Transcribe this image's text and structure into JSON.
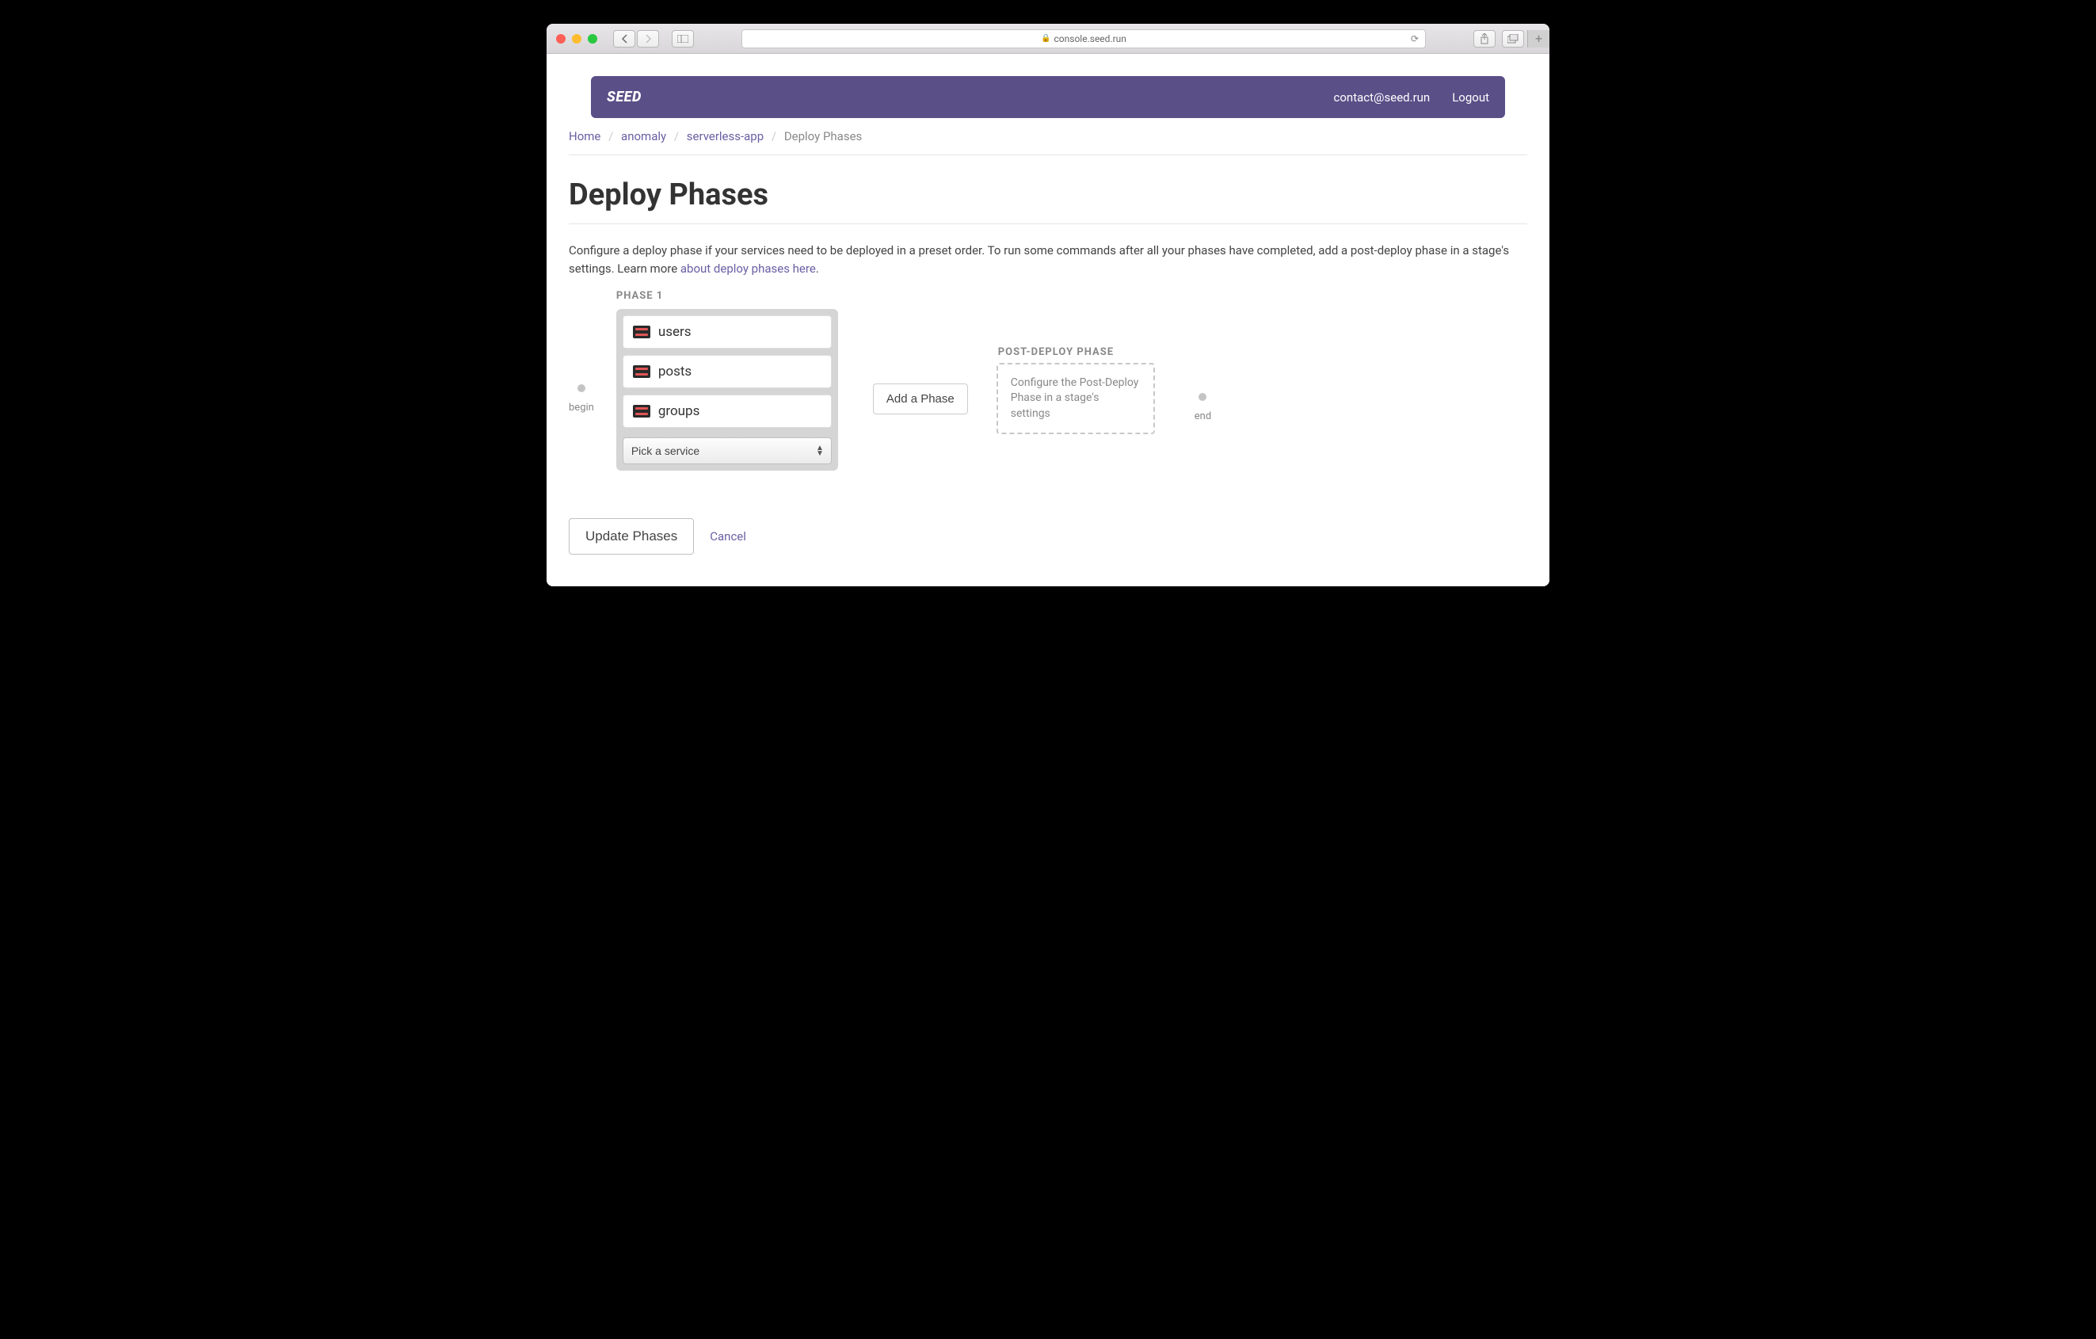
{
  "browser": {
    "url": "console.seed.run"
  },
  "nav": {
    "logo": "SEED",
    "email": "contact@seed.run",
    "logout": "Logout"
  },
  "breadcrumb": {
    "items": [
      {
        "label": "Home"
      },
      {
        "label": "anomaly"
      },
      {
        "label": "serverless-app"
      }
    ],
    "current": "Deploy Phases"
  },
  "page": {
    "title": "Deploy Phases",
    "description_pre": "Configure a deploy phase if your services need to be deployed in a preset order. To run some commands after all your phases have completed, add a post-deploy phase in a stage's settings. Learn more ",
    "description_link": "about deploy phases here",
    "description_post": "."
  },
  "phases": {
    "begin_label": "begin",
    "end_label": "end",
    "phase_label": "PHASE 1",
    "services": [
      {
        "name": "users"
      },
      {
        "name": "posts"
      },
      {
        "name": "groups"
      }
    ],
    "select_placeholder": "Pick a service",
    "add_phase_label": "Add a Phase",
    "post_deploy_header": "POST-DEPLOY PHASE",
    "post_deploy_text": "Configure the Post-Deploy Phase in a stage's settings"
  },
  "actions": {
    "update": "Update Phases",
    "cancel": "Cancel"
  }
}
